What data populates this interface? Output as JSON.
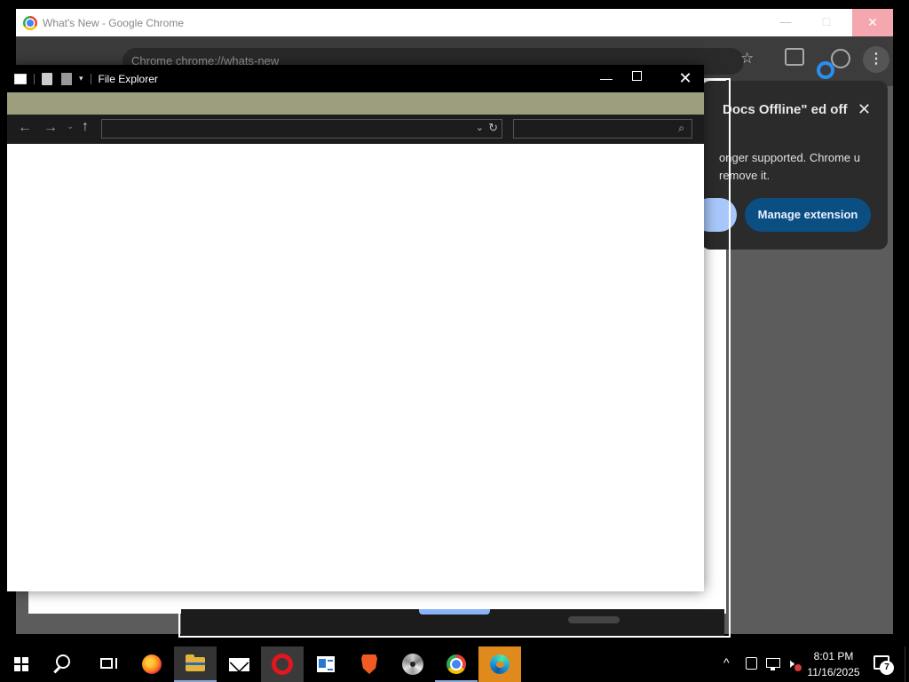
{
  "chrome": {
    "window_title": "What's New - Google Chrome",
    "minimize": "—",
    "maximize": "☐",
    "close": "✕",
    "address_bar_text": "Chrome  chrome://whats-new",
    "bookmark_icon": "star-icon",
    "menu_label": "⋮",
    "colors": {
      "toolbar": "#3c3c3c",
      "close_hover": "#f4a7ae"
    }
  },
  "extension_bubble": {
    "title": "Docs Offline\" ed off",
    "body": "onger supported. Chrome u remove it.",
    "manage_button": "Manage extension",
    "close": "✕",
    "colors": {
      "primary_button": "#0b4f82",
      "secondary_button": "#a8c7fa"
    }
  },
  "file_explorer": {
    "window_title": "File Explorer",
    "minimize": "—",
    "close": "✕",
    "back": "←",
    "forward": "→",
    "recent": "⌄",
    "up": "↑",
    "address_value": "",
    "address_dropdown": "⌄",
    "refresh": "↻",
    "search_placeholder": "",
    "search_icon": "⌕",
    "dropdown_arrow": "▾",
    "colors": {
      "ribbon": "#9c9e7e",
      "navbar": "#1c1c1c"
    }
  },
  "taskbar": {
    "apps": [
      "firefox",
      "file-explorer",
      "mail",
      "opera",
      "news",
      "brave",
      "dvd-player",
      "chrome",
      "edge"
    ],
    "tray_chevron": "^",
    "volume_icon": "🕨",
    "clock_time": "8:01 PM",
    "clock_date": "11/16/2025",
    "notification_count": "7"
  }
}
